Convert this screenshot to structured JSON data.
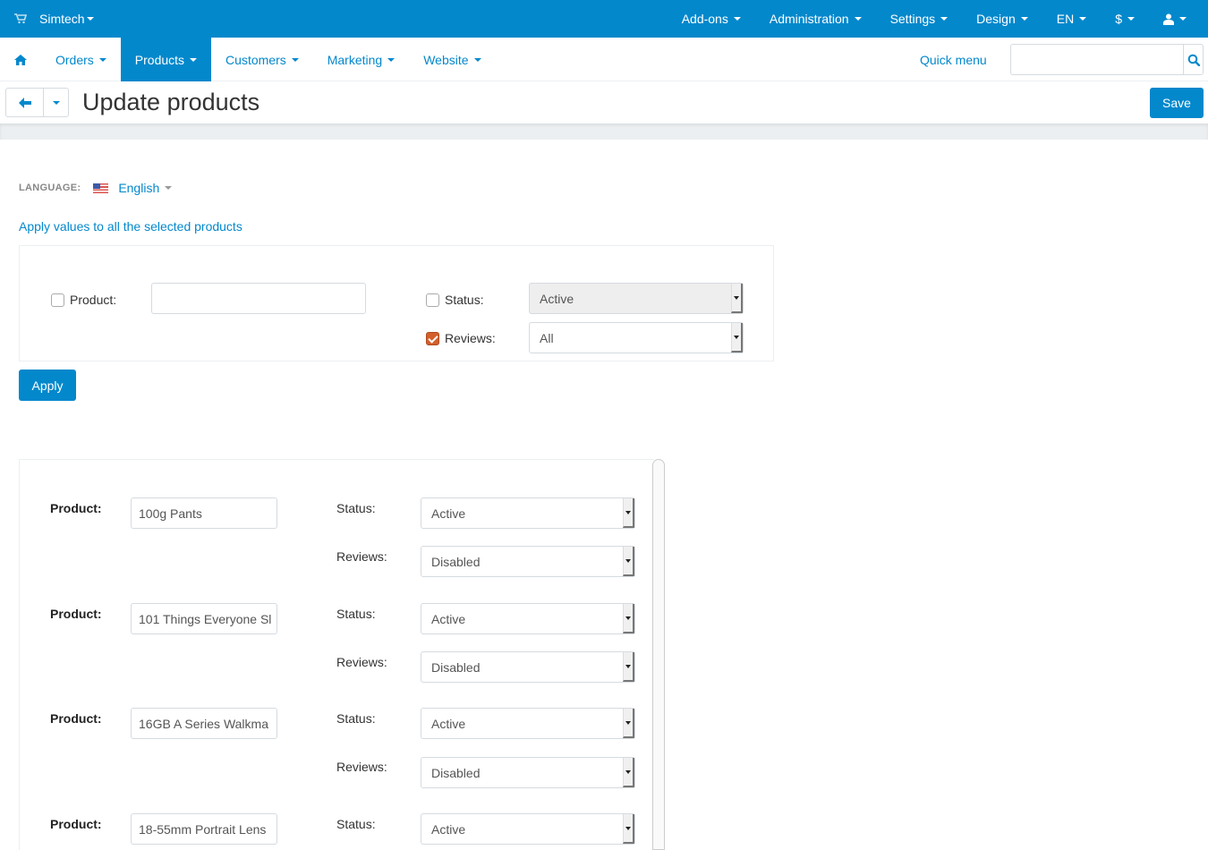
{
  "topbar": {
    "brand": "Simtech",
    "items": [
      {
        "label": "Add-ons"
      },
      {
        "label": "Administration"
      },
      {
        "label": "Settings"
      },
      {
        "label": "Design"
      },
      {
        "label": "EN"
      },
      {
        "label": "$"
      },
      {
        "label": "",
        "icon": "user-icon"
      }
    ]
  },
  "navbar": {
    "items": [
      {
        "label": "Orders",
        "active": false
      },
      {
        "label": "Products",
        "active": true
      },
      {
        "label": "Customers",
        "active": false
      },
      {
        "label": "Marketing",
        "active": false
      },
      {
        "label": "Website",
        "active": false
      }
    ],
    "quick_menu": "Quick menu",
    "search_value": "",
    "search_placeholder": ""
  },
  "header": {
    "title": "Update products",
    "save_label": "Save"
  },
  "language": {
    "label": "LANGUAGE:",
    "value": "English"
  },
  "apply_section": {
    "title": "Apply values to all the selected products",
    "product": {
      "label": "Product:",
      "checked": false,
      "value": ""
    },
    "status": {
      "label": "Status:",
      "checked": false,
      "value": "Active"
    },
    "reviews": {
      "label": "Reviews:",
      "checked": true,
      "value": "All"
    },
    "apply_label": "Apply"
  },
  "products": {
    "product_label": "Product:",
    "status_label": "Status:",
    "reviews_label": "Reviews:",
    "rows": [
      {
        "name": "100g Pants",
        "status": "Active",
        "reviews": "Disabled"
      },
      {
        "name": "101 Things Everyone Sl",
        "status": "Active",
        "reviews": "Disabled"
      },
      {
        "name": "16GB A Series Walkma",
        "status": "Active",
        "reviews": "Disabled"
      },
      {
        "name": "18-55mm Portrait Lens",
        "status": "Active",
        "reviews": ""
      }
    ]
  }
}
